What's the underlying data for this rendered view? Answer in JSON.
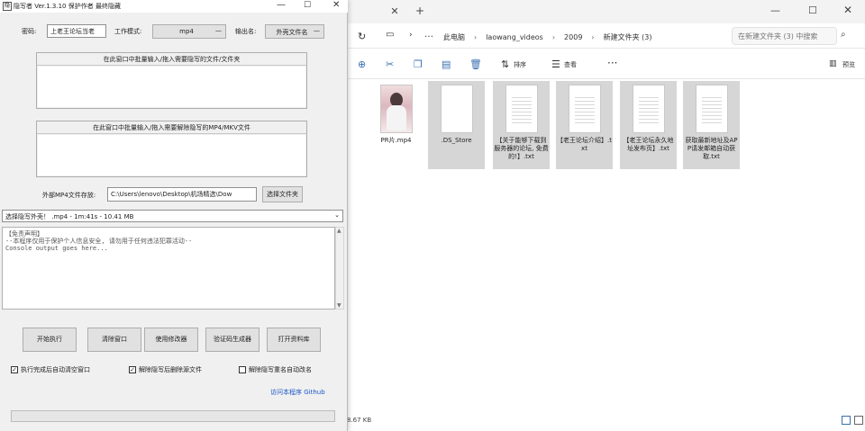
{
  "explorer": {
    "breadcrumb": [
      "此电脑",
      "laowang_videos",
      "2009",
      "新建文件夹 (3)"
    ],
    "search_placeholder": "在新建文件夹 (3) 中搜索",
    "toolbar": {
      "sort_label": "排序",
      "view_label": "查看",
      "preview_label": "预览"
    },
    "files": [
      {
        "name": "PR片.mp4",
        "kind": "photo",
        "selected": false
      },
      {
        "name": ".DS_Store",
        "kind": "blank",
        "selected": true
      },
      {
        "name": "【关于能够下载到服务器的论坛, 免费的!】.txt",
        "kind": "text",
        "selected": true
      },
      {
        "name": "【老王论坛介绍】.txt",
        "kind": "text",
        "selected": true
      },
      {
        "name": "【老王论坛永久地址发布页】.txt",
        "kind": "text",
        "selected": true
      },
      {
        "name": "获取最新地址及APP请发邮箱自动获取.txt",
        "kind": "text",
        "selected": true
      }
    ],
    "status_text": "8.67 KB"
  },
  "app": {
    "title": "隐写者 Ver.1.3.10 保护作者 最终隐藏",
    "labels": {
      "password": "密码:",
      "mode": "工作模式:",
      "output_name": "输出名:",
      "external_path": "外部MP4文件存放:"
    },
    "password_value": "上老王论坛当老",
    "mode_value": "mp4",
    "output_value": "外壳文件名",
    "group1_title": "在此窗口中批量输入/拖入需要隐写的文件/文件夹",
    "group2_title": "在此窗口中批量输入/拖入需要解除隐写的MP4/MKV文件",
    "external_path_value": "C:\\Users\\lenovo\\Desktop\\机场精选\\Dow",
    "select_folder_label": "选择文件夹",
    "combo_value": "选择隐写外壳！ .mp4 - 1m:41s - 10.41 MB",
    "console_text": "【免责声明】\n--本程序仅用于保护个人信息安全, 请勿用于任何违法犯罪活动--\nConsole output goes here...",
    "buttons": [
      "开始执行",
      "清除窗口",
      "使用修改器",
      "验证码生成器",
      "打开资料库"
    ],
    "checkboxes": [
      {
        "label": "执行完成后自动清空窗口",
        "checked": true
      },
      {
        "label": "解除隐写后删除源文件",
        "checked": true
      },
      {
        "label": "解除隐写重名自动改名",
        "checked": false
      }
    ],
    "link_text": "访问本程序 Github",
    "progress": 0
  },
  "colors": {
    "link": "#1a55c9",
    "selection": "#d6d6d6",
    "accent": "#3a6fb0"
  }
}
